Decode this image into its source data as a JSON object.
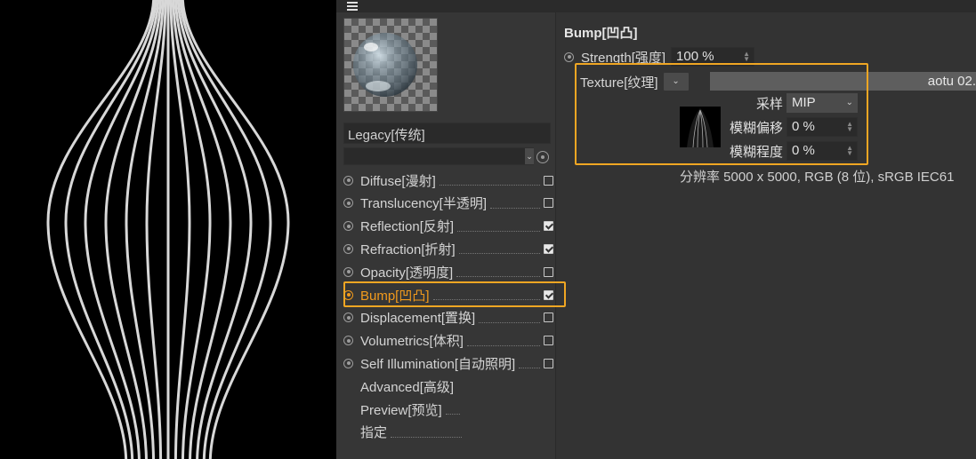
{
  "menu_icon": "hamburger-icon",
  "preset": {
    "value": "Legacy[传统]"
  },
  "channels": [
    {
      "label": "Diffuse[漫射]",
      "checked": false,
      "dot": true
    },
    {
      "label": "Translucency[半透明]",
      "checked": false,
      "dot": true
    },
    {
      "label": "Reflection[反射]",
      "checked": true,
      "dot": true
    },
    {
      "label": "Refraction[折射]",
      "checked": true,
      "dot": true
    },
    {
      "label": "Opacity[透明度]",
      "checked": false,
      "dot": true
    },
    {
      "label": "Bump[凹凸]",
      "checked": true,
      "dot": true,
      "active": true
    },
    {
      "label": "Displacement[置换]",
      "checked": false,
      "dot": true
    },
    {
      "label": "Volumetrics[体积]",
      "checked": false,
      "dot": true
    },
    {
      "label": "Self Illumination[自动照明]",
      "checked": false,
      "dot": true
    },
    {
      "label": "Advanced[高级]",
      "checked": null,
      "dot": false,
      "leader": false
    },
    {
      "label": "Preview[预览]",
      "checked": null,
      "dot": false,
      "leader": true
    },
    {
      "label": "指定",
      "checked": null,
      "dot": false,
      "leader": true
    }
  ],
  "bump": {
    "title": "Bump[凹凸]",
    "strength_label": "Strength[强度]",
    "strength_value": "100 %",
    "texture_label": "Texture[纹理]",
    "texture_name": "aotu 02.",
    "sampling_label": "采样",
    "sampling_value": "MIP",
    "blur_offset_label": "模糊偏移",
    "blur_offset_value": "0 %",
    "blur_scale_label": "模糊程度",
    "blur_scale_value": "0 %",
    "resolution": "分辨率 5000 x 5000, RGB (8 位), sRGB IEC61"
  },
  "colors": {
    "accent": "#f29a1c",
    "highlight_box": "#f0a623",
    "panel_bg": "#333333",
    "viewport_bg": "#000000"
  }
}
